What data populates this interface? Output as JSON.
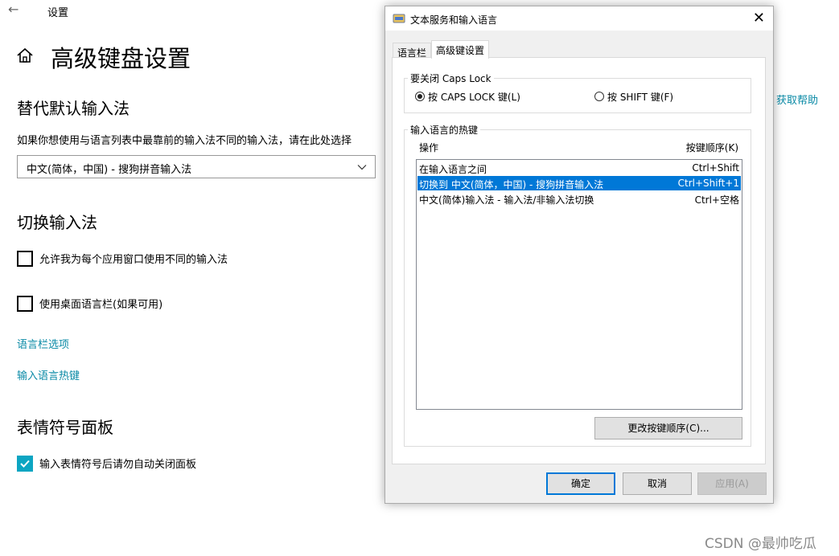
{
  "settings": {
    "back_icon": "back-arrow-icon",
    "window_title": "设置",
    "home_icon": "home-icon",
    "page_title": "高级键盘设置",
    "help_link": "获取帮助",
    "override_section": {
      "title": "替代默认输入法",
      "description": "如果你想使用与语言列表中最靠前的输入法不同的输入法，请在此处选择",
      "selected_ime": "中文(简体，中国) - 搜狗拼音输入法"
    },
    "switch_section": {
      "title": "切换输入法",
      "per_app_checkbox": {
        "label": "允许我为每个应用窗口使用不同的输入法",
        "checked": false
      },
      "desktop_bar_checkbox": {
        "label": "使用桌面语言栏(如果可用)",
        "checked": false
      },
      "language_bar_link": "语言栏选项",
      "hotkeys_link": "输入语言热键"
    },
    "emoji_section": {
      "title": "表情符号面板",
      "auto_close_checkbox": {
        "label": "输入表情符号后请勿自动关闭面板",
        "checked": true
      }
    },
    "accent_color": "#0ca5c2"
  },
  "dialog": {
    "title": "文本服务和输入语言",
    "tabs": [
      {
        "label": "语言栏",
        "active": false
      },
      {
        "label": "高级键设置",
        "active": true
      }
    ],
    "caps_group": {
      "legend": "要关闭 Caps Lock",
      "option_caps": {
        "label": "按 CAPS LOCK 键(L)",
        "selected": true
      },
      "option_shift": {
        "label": "按 SHIFT 键(F)",
        "selected": false
      }
    },
    "hotkey_group": {
      "legend": "输入语言的热键",
      "col_action": "操作",
      "col_keys": "按键顺序(K)",
      "rows": [
        {
          "action": "在输入语言之间",
          "keys": "Ctrl+Shift",
          "selected": false
        },
        {
          "action": "切换到 中文(简体，中国) - 搜狗拼音输入法",
          "keys": "Ctrl+Shift+1",
          "selected": true
        },
        {
          "action": "中文(简体)输入法 - 输入法/非输入法切换",
          "keys": "Ctrl+空格",
          "selected": false
        }
      ],
      "change_button": "更改按键顺序(C)..."
    },
    "buttons": {
      "ok": "确定",
      "cancel": "取消",
      "apply": "应用(A)"
    },
    "selection_color": "#0078d7"
  },
  "watermark": "CSDN @最帅吃瓜"
}
